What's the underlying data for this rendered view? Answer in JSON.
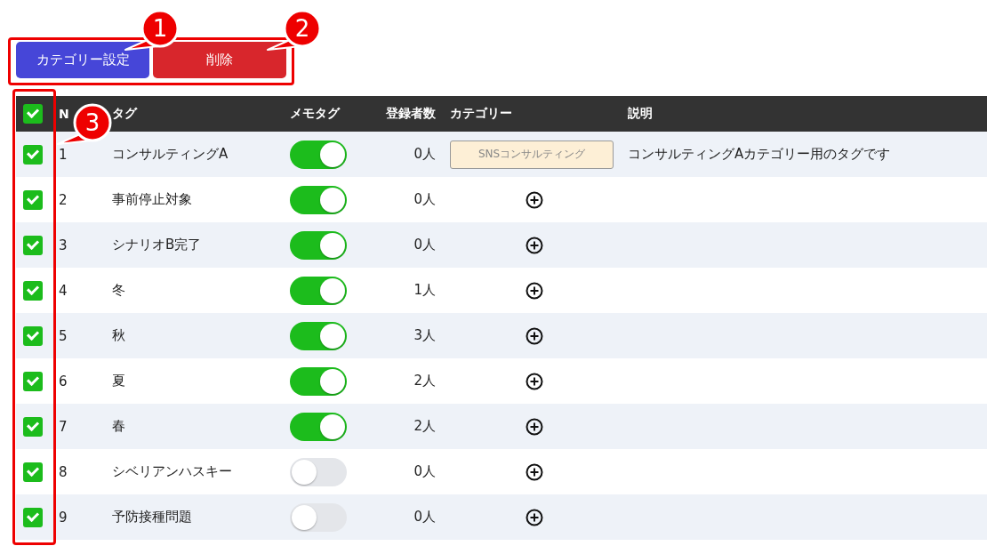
{
  "buttons": [
    {
      "label": "カテゴリー設定",
      "kind": "primary"
    },
    {
      "label": "削除",
      "kind": "danger"
    }
  ],
  "table": {
    "select_all": {
      "checked": true
    },
    "columns": [
      "N",
      "タグ",
      "メモタグ",
      "登録者数",
      "カテゴリー",
      "説明"
    ],
    "rows": [
      {
        "checked": true,
        "no": "1",
        "tag": "コンサルティングA",
        "memo_tag_on": true,
        "count": "0人",
        "category": "SNSコンサルティング",
        "description": "コンサルティングAカテゴリー用のタグです"
      },
      {
        "checked": true,
        "no": "2",
        "tag": "事前停止対象",
        "memo_tag_on": true,
        "count": "0人"
      },
      {
        "checked": true,
        "no": "3",
        "tag": "シナリオB完了",
        "memo_tag_on": true,
        "count": "0人"
      },
      {
        "checked": true,
        "no": "4",
        "tag": "冬",
        "memo_tag_on": true,
        "count": "1人"
      },
      {
        "checked": true,
        "no": "5",
        "tag": "秋",
        "memo_tag_on": true,
        "count": "3人"
      },
      {
        "checked": true,
        "no": "6",
        "tag": "夏",
        "memo_tag_on": true,
        "count": "2人"
      },
      {
        "checked": true,
        "no": "7",
        "tag": "春",
        "memo_tag_on": true,
        "count": "2人"
      },
      {
        "checked": true,
        "no": "8",
        "tag": "シベリアンハスキー",
        "memo_tag_on": false,
        "count": "0人"
      },
      {
        "checked": true,
        "no": "9",
        "tag": "予防接種問題",
        "memo_tag_on": false,
        "count": "0人"
      }
    ]
  },
  "callouts": [
    "1",
    "2",
    "3"
  ]
}
